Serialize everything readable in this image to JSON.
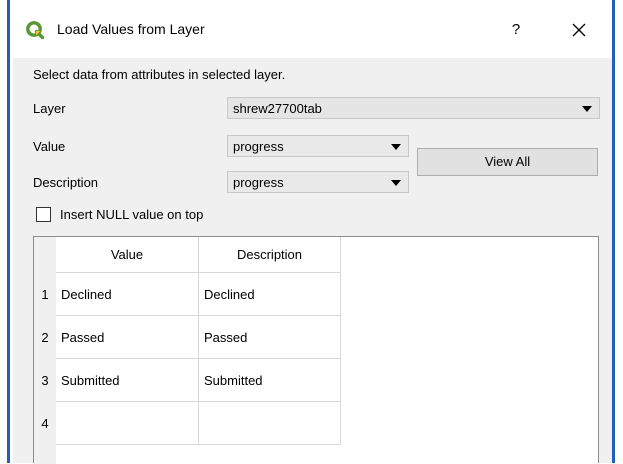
{
  "window": {
    "title": "Load Values from Layer",
    "help_label": "?",
    "close_label": "×"
  },
  "form": {
    "instruction": "Select data from attributes in selected layer.",
    "layer_label": "Layer",
    "layer_selected": "shrew27700tab",
    "value_label": "Value",
    "value_selected": "progress",
    "description_label": "Description",
    "description_selected": "progress",
    "view_all_label": "View All",
    "insert_null_label": "Insert NULL value on top",
    "insert_null_checked": false
  },
  "table": {
    "columns": [
      "Value",
      "Description"
    ],
    "rows": [
      {
        "num": "1",
        "value": "Declined",
        "description": "Declined"
      },
      {
        "num": "2",
        "value": "Passed",
        "description": "Passed"
      },
      {
        "num": "3",
        "value": "Submitted",
        "description": "Submitted"
      },
      {
        "num": "4",
        "value": "",
        "description": ""
      }
    ]
  },
  "colors": {
    "qgis_green": "#589632",
    "qgis_yellow": "#f0c419",
    "frame_blue": "#1f5fbf"
  },
  "icons": {
    "app": "qgis-logo-icon",
    "close": "close-icon",
    "combo_arrow": "chevron-down-icon"
  }
}
